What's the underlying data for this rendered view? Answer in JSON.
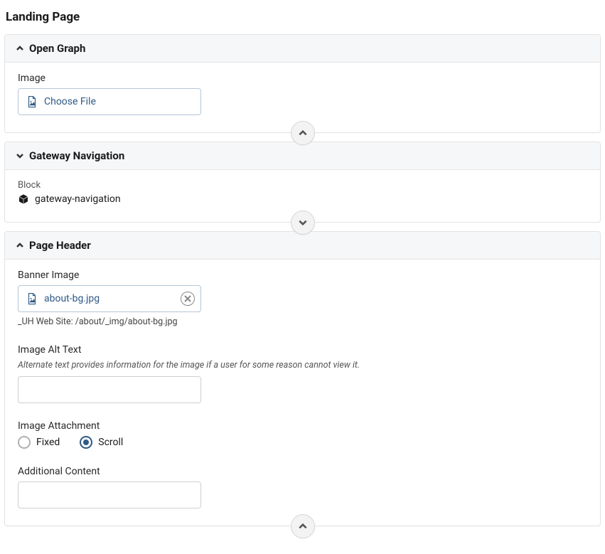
{
  "page_title": "Landing Page",
  "panels": {
    "open_graph": {
      "title": "Open Graph",
      "expanded": true,
      "fields": {
        "image": {
          "label": "Image",
          "choose_label": "Choose File"
        }
      },
      "fab_direction": "up"
    },
    "gateway_nav": {
      "title": "Gateway Navigation",
      "expanded": false,
      "fields": {
        "block": {
          "label": "Block",
          "value": "gateway-navigation"
        }
      },
      "fab_direction": "down"
    },
    "page_header": {
      "title": "Page Header",
      "expanded": true,
      "fields": {
        "banner_image": {
          "label": "Banner Image",
          "file_name": "about-bg.jpg",
          "path": "_UH Web Site: /about/_img/about-bg.jpg"
        },
        "alt_text": {
          "label": "Image Alt Text",
          "helper": "Alternate text provides information for the image if a user for some reason cannot view it.",
          "value": ""
        },
        "image_attachment": {
          "label": "Image Attachment",
          "options": [
            {
              "label": "Fixed",
              "selected": false
            },
            {
              "label": "Scroll",
              "selected": true
            }
          ]
        },
        "additional_content": {
          "label": "Additional Content",
          "value": ""
        }
      },
      "fab_direction": "up"
    }
  }
}
